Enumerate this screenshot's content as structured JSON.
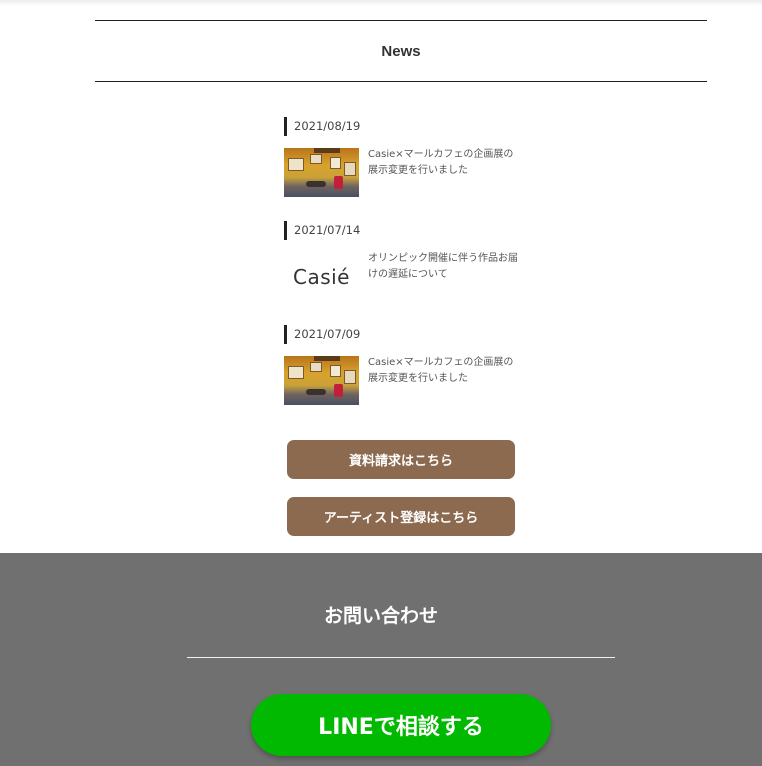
{
  "news": {
    "heading": "News",
    "items": [
      {
        "date": "2021/08/19",
        "thumb": "photo",
        "title": "Casie×マールカフェの企画展の展示変更を行いました"
      },
      {
        "date": "2021/07/14",
        "thumb": "logo",
        "logo_text": "Casié",
        "title": "オリンピック開催に伴う作品お届けの遅延について"
      },
      {
        "date": "2021/07/09",
        "thumb": "photo",
        "title": "Casie×マールカフェの企画展の展示変更を行いました"
      }
    ]
  },
  "buttons": {
    "request_docs": "資料請求はこちら",
    "artist_signup": "アーティスト登録はこちら"
  },
  "contact": {
    "title": "お問い合わせ",
    "line_button": "LINEで相談する"
  },
  "colors": {
    "button_brown": "#8c6a4f",
    "contact_bg": "#707070",
    "line_green": "#00b900"
  }
}
